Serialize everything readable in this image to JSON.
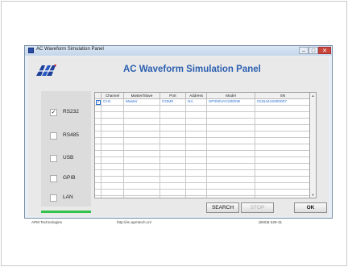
{
  "window": {
    "title": "AC Waveform Simulation Panel",
    "controls": {
      "minimize": "–",
      "maximize": "□",
      "close": "✕"
    }
  },
  "header": {
    "logo_icon": "apm-logo",
    "title": "AC Waveform Simulation Panel"
  },
  "interfaces": [
    {
      "label": "RS232",
      "checked": true,
      "check_glyph": "✓"
    },
    {
      "label": "RS485",
      "checked": false,
      "check_glyph": ""
    },
    {
      "label": "USB",
      "checked": false,
      "check_glyph": ""
    },
    {
      "label": "GPIB",
      "checked": false,
      "check_glyph": ""
    },
    {
      "label": "LAN",
      "checked": false,
      "check_glyph": ""
    }
  ],
  "progress": {
    "fraction": 1.0,
    "color": "#32c24a"
  },
  "table": {
    "headers": [
      "Channel",
      "Master/Slave",
      "Port",
      "Address",
      "Model",
      "SN"
    ],
    "rows": [
      {
        "checked": true,
        "check_glyph": "✓",
        "cells": [
          "CH1",
          "Master",
          "COM8",
          "NA",
          "SP300VAC2000W",
          "01154416300007"
        ]
      }
    ],
    "empty_row_count": 16
  },
  "scrollbar": {
    "up_icon": "▲",
    "down_icon": "▼"
  },
  "buttons": {
    "search": "SEARCH",
    "stop": "STOP",
    "ok": "OK"
  },
  "status_bar": {
    "company": "APM Technologies",
    "url": "http://en.apmtech.cn/",
    "phone": "(800)8-329-31"
  },
  "colors": {
    "accent": "#2b5fb0",
    "value_text": "#2a70d0"
  }
}
